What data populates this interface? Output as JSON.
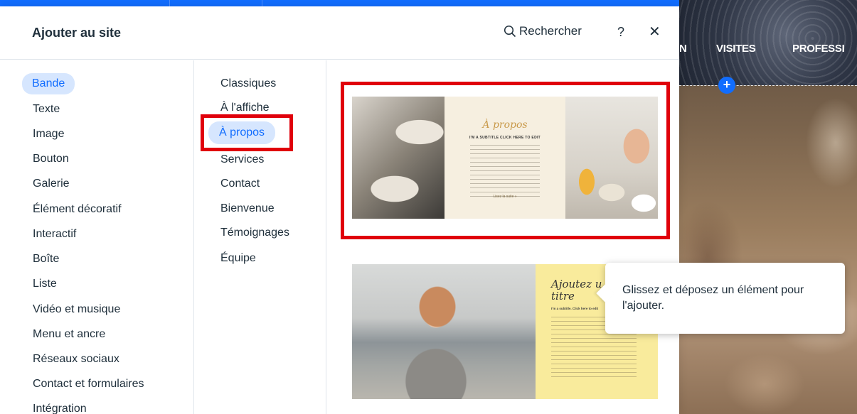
{
  "panel": {
    "title": "Ajouter au site",
    "search_label": "Rechercher",
    "help_label": "?",
    "close_label": "✕"
  },
  "categories": [
    {
      "label": "Bande",
      "selected": true
    },
    {
      "label": "Texte"
    },
    {
      "label": "Image"
    },
    {
      "label": "Bouton"
    },
    {
      "label": "Galerie"
    },
    {
      "label": "Élément décoratif"
    },
    {
      "label": "Interactif"
    },
    {
      "label": "Boîte"
    },
    {
      "label": "Liste"
    },
    {
      "label": "Vidéo et musique"
    },
    {
      "label": "Menu et ancre"
    },
    {
      "label": "Réseaux sociaux"
    },
    {
      "label": "Contact et formulaires"
    },
    {
      "label": "Intégration"
    }
  ],
  "subcategories": [
    {
      "label": "Classiques"
    },
    {
      "label": "À l'affiche"
    },
    {
      "label": "À propos",
      "selected": true
    },
    {
      "label": "Services"
    },
    {
      "label": "Contact"
    },
    {
      "label": "Bienvenue"
    },
    {
      "label": "Témoignages"
    },
    {
      "label": "Équipe"
    }
  ],
  "previews": {
    "card1": {
      "title": "À propos",
      "subtitle": "I'M A SUBTITLE CLICK HERE TO EDIT",
      "link": "Lisez la suite »"
    },
    "card2": {
      "title_line1": "Ajoutez u",
      "title_line2": "titre",
      "subtitle": "I'm a subtitle. Click here to edit"
    }
  },
  "tooltip": {
    "text": "Glissez et déposez un élément pour l'ajouter."
  },
  "site": {
    "nav_items": [
      "N",
      "VISITES",
      "PROFESSI"
    ],
    "add_label": "+"
  },
  "colors": {
    "accent": "#116dff",
    "selected_bg": "#d6e6fe",
    "highlight_box": "#e0000b"
  }
}
